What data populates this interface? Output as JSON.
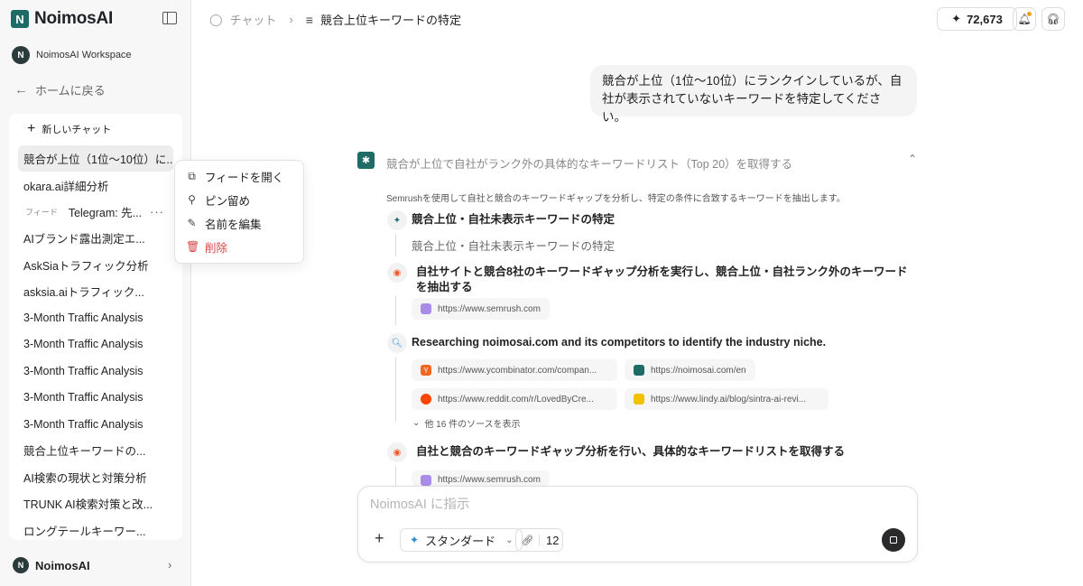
{
  "brand": {
    "name": "NoimosAI",
    "logo_glyph": "N"
  },
  "workspace": {
    "name": "NoimosAI Workspace",
    "avatar_glyph": "N"
  },
  "sidebar": {
    "back_label": "ホームに戻る",
    "new_chat_label": "新しいチャット",
    "chats": [
      {
        "label": "競合が上位（1位〜10位）に..."
      },
      {
        "label": "okara.ai詳細分析"
      },
      {
        "label": "Telegram: 先...",
        "tag": "フィード"
      },
      {
        "label": "AIブランド露出測定エ..."
      },
      {
        "label": "AskSiaトラフィック分析"
      },
      {
        "label": "asksia.aiトラフィック..."
      },
      {
        "label": "3-Month Traffic Analysis"
      },
      {
        "label": "3-Month Traffic Analysis"
      },
      {
        "label": "3-Month Traffic Analysis"
      },
      {
        "label": "3-Month Traffic Analysis"
      },
      {
        "label": "3-Month Traffic Analysis"
      },
      {
        "label": "競合上位キーワードの..."
      },
      {
        "label": "AI検索の現状と対策分析"
      },
      {
        "label": "TRUNK AI検索対策と改..."
      },
      {
        "label": "ロングテールキーワー..."
      }
    ],
    "footer_name": "NoimosAI"
  },
  "context_menu": {
    "items": [
      {
        "label": "フィードを開く",
        "icon": "open-feed-icon"
      },
      {
        "label": "ピン留め",
        "icon": "pin-icon"
      },
      {
        "label": "名前を編集",
        "icon": "edit-icon"
      },
      {
        "label": "削除",
        "icon": "trash-icon"
      }
    ]
  },
  "header": {
    "crumb_chat": "チャット",
    "crumb_title": "競合上位キーワードの特定",
    "credits": "72,673"
  },
  "conversation": {
    "user_message": "競合が上位（1位〜10位）にランクインしているが、自社が表示されていないキーワードを特定してください。",
    "task_title": "競合が上位で自社がランク外の具体的なキーワードリスト（Top 20）を取得する",
    "task_description": "Semrushを使用して自社と競合のキーワードギャップを分析し、特定の条件に合致するキーワードを抽出します。",
    "steps": [
      {
        "title": "競合上位・自社未表示キーワードの特定",
        "sub": "競合上位・自社未表示キーワードの特定"
      },
      {
        "title": "自社サイトと競合8社のキーワードギャップ分析を実行し、競合上位・自社ランク外のキーワードを抽出する"
      },
      {
        "title": "Researching noimosai.com and its competitors to identify the industry niche."
      },
      {
        "title": "自社と競合のキーワードギャップ分析を行い、具体的なキーワードリストを取得する"
      }
    ],
    "sources": {
      "semrush": "https://www.semrush.com",
      "ycombinator": "https://www.ycombinator.com/compan...",
      "noimosai": "https://noimosai.com/en",
      "reddit": "https://www.reddit.com/r/LovedByCre...",
      "lindy": "https://www.lindy.ai/blog/sintra-ai-revi...",
      "more_label": "他 16 件のソースを表示"
    }
  },
  "composer": {
    "placeholder": "NoimosAI に指示",
    "mode_label": "スタンダード",
    "link_count": "12"
  },
  "colors": {
    "brand": "#1f6b66",
    "danger": "#d64545",
    "accent": "#2a8bd0"
  }
}
